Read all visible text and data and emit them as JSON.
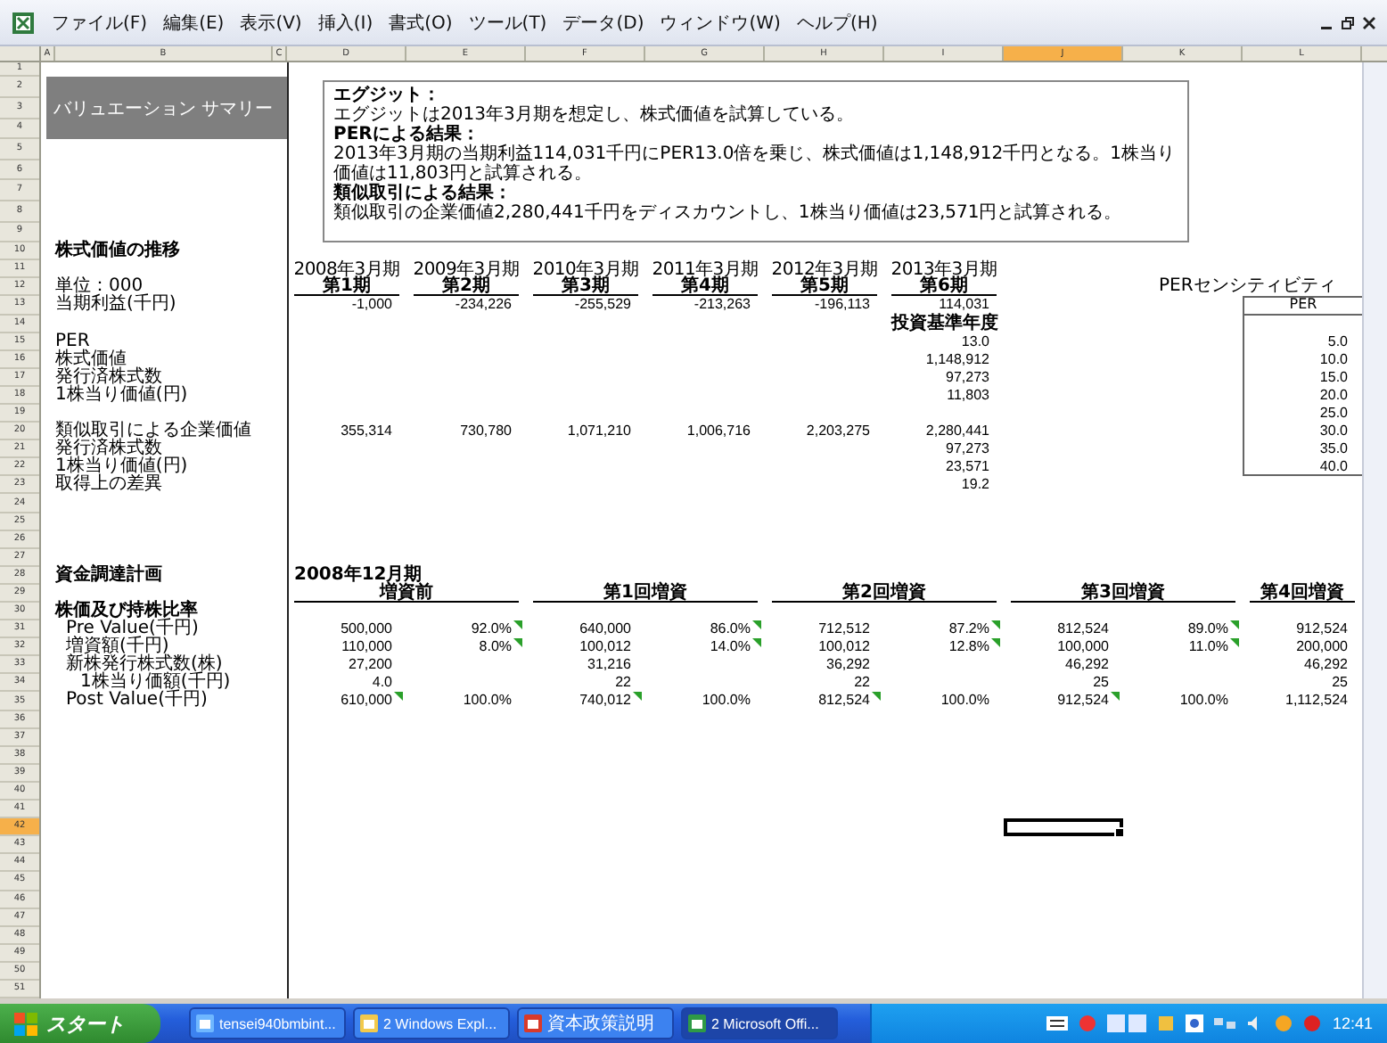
{
  "menu_bar": {
    "items": [
      "ファイル(F)",
      "編集(E)",
      "表示(V)",
      "挿入(I)",
      "書式(O)",
      "ツール(T)",
      "データ(D)",
      "ウィンドウ(W)",
      "ヘルプ(H)"
    ]
  },
  "columns": [
    {
      "label": "A",
      "selected": false
    },
    {
      "label": "B",
      "selected": false
    },
    {
      "label": "C",
      "selected": false
    },
    {
      "label": "D",
      "selected": false
    },
    {
      "label": "E",
      "selected": false
    },
    {
      "label": "F",
      "selected": false
    },
    {
      "label": "G",
      "selected": false
    },
    {
      "label": "H",
      "selected": false
    },
    {
      "label": "I",
      "selected": false
    },
    {
      "label": "J",
      "selected": true
    },
    {
      "label": "K",
      "selected": false
    },
    {
      "label": "L",
      "selected": false
    }
  ],
  "rows": [
    {
      "label": "1",
      "selected": false
    },
    {
      "label": "2",
      "selected": false
    },
    {
      "label": "3",
      "selected": false
    },
    {
      "label": "4",
      "selected": false
    },
    {
      "label": "5",
      "selected": false
    },
    {
      "label": "6",
      "selected": false
    },
    {
      "label": "7",
      "selected": false
    },
    {
      "label": "8",
      "selected": false
    },
    {
      "label": "9",
      "selected": false
    },
    {
      "label": "10",
      "selected": false
    },
    {
      "label": "11",
      "selected": false
    },
    {
      "label": "12",
      "selected": false
    },
    {
      "label": "13",
      "selected": false
    },
    {
      "label": "14",
      "selected": false
    },
    {
      "label": "15",
      "selected": false
    },
    {
      "label": "16",
      "selected": false
    },
    {
      "label": "17",
      "selected": false
    },
    {
      "label": "18",
      "selected": false
    },
    {
      "label": "19",
      "selected": false
    },
    {
      "label": "20",
      "selected": false
    },
    {
      "label": "21",
      "selected": false
    },
    {
      "label": "22",
      "selected": false
    },
    {
      "label": "23",
      "selected": false
    },
    {
      "label": "24",
      "selected": false
    },
    {
      "label": "25",
      "selected": false
    },
    {
      "label": "26",
      "selected": false
    },
    {
      "label": "27",
      "selected": false
    },
    {
      "label": "28",
      "selected": false
    },
    {
      "label": "29",
      "selected": false
    },
    {
      "label": "30",
      "selected": false
    },
    {
      "label": "31",
      "selected": false
    },
    {
      "label": "32",
      "selected": false
    },
    {
      "label": "33",
      "selected": false
    },
    {
      "label": "34",
      "selected": false
    },
    {
      "label": "35",
      "selected": false
    },
    {
      "label": "36",
      "selected": false
    },
    {
      "label": "37",
      "selected": false
    },
    {
      "label": "38",
      "selected": false
    },
    {
      "label": "39",
      "selected": false
    },
    {
      "label": "40",
      "selected": false
    },
    {
      "label": "41",
      "selected": false
    },
    {
      "label": "42",
      "selected": true
    },
    {
      "label": "43",
      "selected": false
    },
    {
      "label": "44",
      "selected": false
    },
    {
      "label": "45",
      "selected": false
    },
    {
      "label": "46",
      "selected": false
    },
    {
      "label": "47",
      "selected": false
    },
    {
      "label": "48",
      "selected": false
    },
    {
      "label": "49",
      "selected": false
    },
    {
      "label": "50",
      "selected": false
    },
    {
      "label": "51",
      "selected": false
    }
  ],
  "title": "バリュエーション サマリー",
  "notes": [
    {
      "heading": "エグジット：",
      "body": "エグジットは2013年3月期を想定し、株式価値を試算している。"
    },
    {
      "heading": "PERによる結果：",
      "body": "2013年3月期の当期利益114,031千円にPER13.0倍を乗じ、株式価値は1,148,912千円となる。1株当り価値は11,803円と試算される。"
    },
    {
      "heading": "類似取引による結果：",
      "body": "類似取引の企業価値2,280,441千円をディスカウントし、1株当り価値は23,571円と試算される。"
    }
  ],
  "valuation": {
    "title": "株式価値の推移",
    "unit": "単位：000",
    "periods": [
      {
        "year": "2008年3月期",
        "term": "第1期"
      },
      {
        "year": "2009年3月期",
        "term": "第2期"
      },
      {
        "year": "2010年3月期",
        "term": "第3期"
      },
      {
        "year": "2011年3月期",
        "term": "第4期"
      },
      {
        "year": "2012年3月期",
        "term": "第5期"
      },
      {
        "year": "2013年3月期",
        "term": "第6期"
      }
    ],
    "profit": {
      "label": "当期利益(千円)",
      "values": [
        "-1,000",
        "-234,226",
        "-255,529",
        "-213,263",
        "-196,113",
        "114,031"
      ]
    },
    "base_year": "投資基準年度",
    "per_rows": [
      {
        "label": "PER",
        "value": "13.0"
      },
      {
        "label": "株式価値",
        "value": "1,148,912"
      },
      {
        "label": "発行済株式数",
        "value": "97,273"
      },
      {
        "label": "1株当り価値(円)",
        "value": "11,803"
      }
    ],
    "deal": {
      "label": "類似取引による企業価値",
      "values": [
        "355,314",
        "730,780",
        "1,071,210",
        "1,006,716",
        "2,203,275",
        "2,280,441"
      ]
    },
    "deal_rows": [
      {
        "label": "発行済株式数",
        "value": "97,273"
      },
      {
        "label": "1株当り価値(円)",
        "value": "23,571"
      },
      {
        "label": "取得上の差異",
        "value": "19.2"
      }
    ]
  },
  "sensitivity": {
    "title": "PERセンシティビティ",
    "header": "PER",
    "values": [
      "5.0",
      "10.0",
      "15.0",
      "20.0",
      "25.0",
      "30.0",
      "35.0",
      "40.0"
    ]
  },
  "financing": {
    "title": "資金調達計画",
    "period": "2008年12月期",
    "subtitle": "株価及び持株比率",
    "rounds": [
      "増資前",
      "第1回増資",
      "第2回増資",
      "第3回増資",
      "第4回増資"
    ],
    "rows": [
      {
        "kind": "line",
        "label": "Pre Value(千円)",
        "groups": [
          {
            "value": {
              "text": "500,000",
              "marked": false
            },
            "share": {
              "text": "92.0%",
              "marked": true
            }
          },
          {
            "value": {
              "text": "640,000",
              "marked": false
            },
            "share": {
              "text": "86.0%",
              "marked": true
            }
          },
          {
            "value": {
              "text": "712,512",
              "marked": false
            },
            "share": {
              "text": "87.2%",
              "marked": true
            }
          },
          {
            "value": {
              "text": "812,524",
              "marked": false
            },
            "share": {
              "text": "89.0%",
              "marked": true
            }
          },
          {
            "value": {
              "text": "912,524",
              "marked": false
            }
          }
        ]
      },
      {
        "kind": "line",
        "label": "増資額(千円)",
        "groups": [
          {
            "value": {
              "text": "110,000",
              "marked": false
            },
            "share": {
              "text": "8.0%",
              "marked": true
            }
          },
          {
            "value": {
              "text": "100,012",
              "marked": false
            },
            "share": {
              "text": "14.0%",
              "marked": true
            }
          },
          {
            "value": {
              "text": "100,012",
              "marked": false
            },
            "share": {
              "text": "12.8%",
              "marked": true
            }
          },
          {
            "value": {
              "text": "100,000",
              "marked": false
            },
            "share": {
              "text": "11.0%",
              "marked": true
            }
          },
          {
            "value": {
              "text": "200,000",
              "marked": false
            }
          }
        ]
      },
      {
        "kind": "line",
        "label": "新株発行株式数(株)",
        "groups": [
          {
            "value": {
              "text": "27,200",
              "marked": false
            }
          },
          {
            "value": {
              "text": "31,216",
              "marked": false
            }
          },
          {
            "value": {
              "text": "36,292",
              "marked": false
            }
          },
          {
            "value": {
              "text": "46,292",
              "marked": false
            }
          },
          {
            "value": {
              "text": "46,292",
              "marked": false
            }
          }
        ]
      },
      {
        "kind": "sub",
        "label": "1株当り価額(千円)",
        "groups": [
          {
            "value": {
              "text": "4.0",
              "marked": false
            }
          },
          {
            "value": {
              "text": "22",
              "marked": false
            }
          },
          {
            "value": {
              "text": "22",
              "marked": false
            }
          },
          {
            "value": {
              "text": "25",
              "marked": false
            }
          },
          {
            "value": {
              "text": "25",
              "marked": false
            }
          }
        ]
      },
      {
        "kind": "line",
        "label": "Post Value(千円)",
        "groups": [
          {
            "value": {
              "text": "610,000",
              "marked": true
            },
            "share": {
              "text": "100.0%",
              "marked": false
            }
          },
          {
            "value": {
              "text": "740,012",
              "marked": true
            },
            "share": {
              "text": "100.0%",
              "marked": false
            }
          },
          {
            "value": {
              "text": "812,524",
              "marked": true
            },
            "share": {
              "text": "100.0%",
              "marked": false
            }
          },
          {
            "value": {
              "text": "912,524",
              "marked": true
            },
            "share": {
              "text": "100.0%",
              "marked": false
            }
          },
          {
            "value": {
              "text": "1,112,524",
              "marked": false
            }
          }
        ]
      }
    ]
  },
  "taskbar": {
    "start": "スタート",
    "tasks": [
      {
        "kind": "image",
        "label": "tensei940bmbint..."
      },
      {
        "kind": "folder",
        "label": "2 Windows Expl..."
      },
      {
        "kind": "app",
        "label": "資本政策説明"
      },
      {
        "kind": "excel",
        "label": "2 Microsoft Offi..."
      }
    ],
    "clock": "12:41"
  }
}
